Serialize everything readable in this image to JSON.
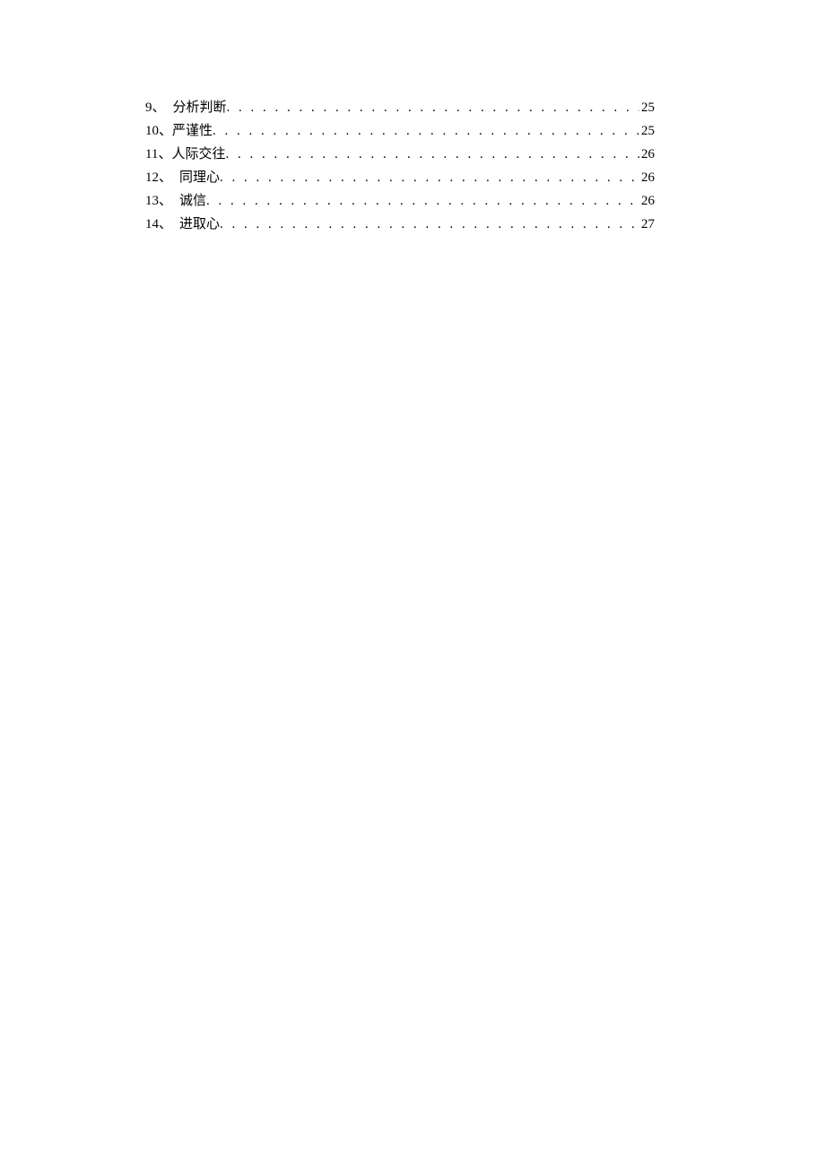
{
  "toc": {
    "entries": [
      {
        "num": "9",
        "sep": "、",
        "title": "分析判断",
        "gap": "",
        "page": "25",
        "pad": true
      },
      {
        "num": "10",
        "sep": "、",
        "title": "严谨性",
        "gap": "",
        "page": "25",
        "pad": false
      },
      {
        "num": "11",
        "sep": "、",
        "title": "人际交往",
        "gap": " ",
        "page": "26",
        "pad": false
      },
      {
        "num": "12",
        "sep": "、",
        "title": "同理心",
        "gap": "",
        "page": "26",
        "pad": true
      },
      {
        "num": "13",
        "sep": "、",
        "title": "诚信",
        "gap": "",
        "page": "26",
        "pad": true
      },
      {
        "num": "14",
        "sep": "、",
        "title": "进取心",
        "gap": "",
        "page": "27",
        "pad": true
      }
    ]
  },
  "dots": ". . . . . . . . . . . . . . . . . . . . . . . . . . . . . . . . . . . . . . . . . . . . . . . . . . . . . . . . . . . . . . . . . . . . . . . . . . . . . . . ."
}
